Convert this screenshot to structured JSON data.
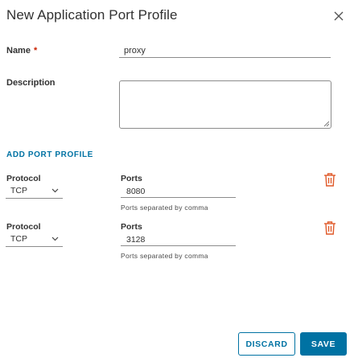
{
  "dialog": {
    "title": "New Application Port Profile",
    "close_icon": "close-icon"
  },
  "form": {
    "name": {
      "label": "Name",
      "required_marker": "*",
      "value": "proxy"
    },
    "description": {
      "label": "Description",
      "value": ""
    },
    "add_port_profile_label": "ADD PORT PROFILE",
    "port_profiles": [
      {
        "protocol_label": "Protocol",
        "protocol_value": "TCP",
        "ports_label": "Ports",
        "ports_value": "8080",
        "helper": "Ports separated by comma",
        "delete_icon": "trash-icon"
      },
      {
        "protocol_label": "Protocol",
        "protocol_value": "TCP",
        "ports_label": "Ports",
        "ports_value": "3128",
        "helper": "Ports separated by comma",
        "delete_icon": "trash-icon"
      }
    ]
  },
  "actions": {
    "discard_label": "DISCARD",
    "save_label": "SAVE"
  },
  "colors": {
    "accent": "#0072a3",
    "danger": "#e05a2a",
    "required": "#c92100",
    "text": "#313131"
  }
}
